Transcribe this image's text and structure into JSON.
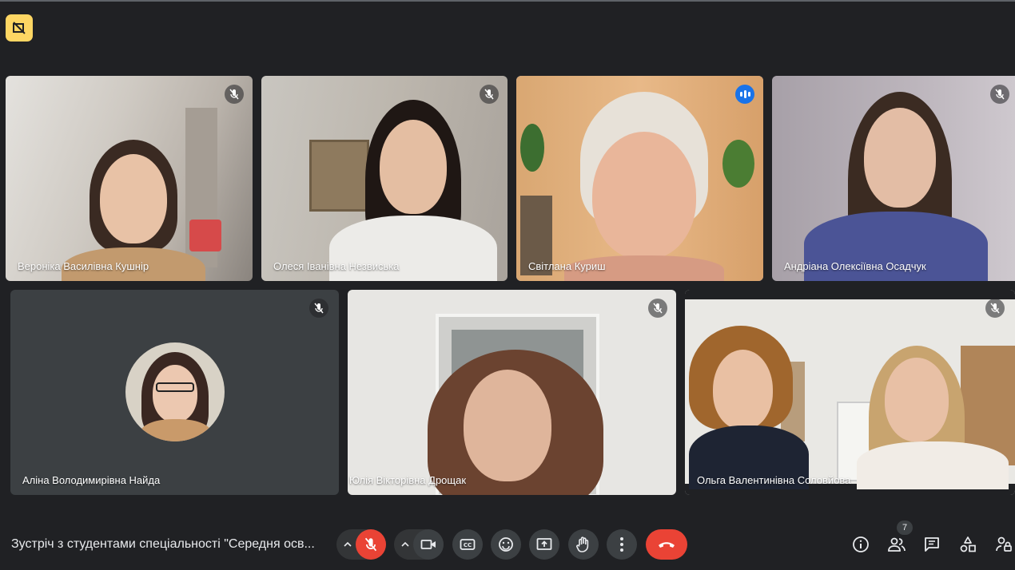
{
  "meeting": {
    "title": "Зустріч з студентами спеціальності \"Середня осв..."
  },
  "participants": [
    {
      "name": "Вероніка Василівна Кушнір",
      "muted": true
    },
    {
      "name": "Олеся Іванівна Незвиська",
      "muted": true
    },
    {
      "name": "Світлана Куриш",
      "muted": false,
      "speaking": true
    },
    {
      "name": "Андріана Олексіївна Осадчук",
      "muted": true
    },
    {
      "name": "Аліна Володимирівна Найда",
      "muted": true,
      "camera_off": true
    },
    {
      "name": "Юлія Вікторівна Дрощак",
      "muted": true
    },
    {
      "name": "Ольга Валентинівна Соловйова",
      "muted": true
    }
  ],
  "people_count": "7",
  "icons": {
    "top_badge": "no-video-frame-icon",
    "mic": "mic-off-icon",
    "camera": "videocam-icon",
    "captions": "closed-captions-icon",
    "reactions": "emoji-icon",
    "present": "present-screen-icon",
    "hand": "raise-hand-icon",
    "more": "more-vertical-icon",
    "leave": "call-end-icon",
    "info": "info-icon",
    "people": "people-icon",
    "chat": "chat-icon",
    "activities": "activities-icon",
    "host": "host-controls-icon"
  },
  "colors": {
    "background": "#202124",
    "active_speaker": "#8ab4f8",
    "mic_off": "#ea4335",
    "leave": "#ea4335",
    "badge": "#fdd663"
  }
}
